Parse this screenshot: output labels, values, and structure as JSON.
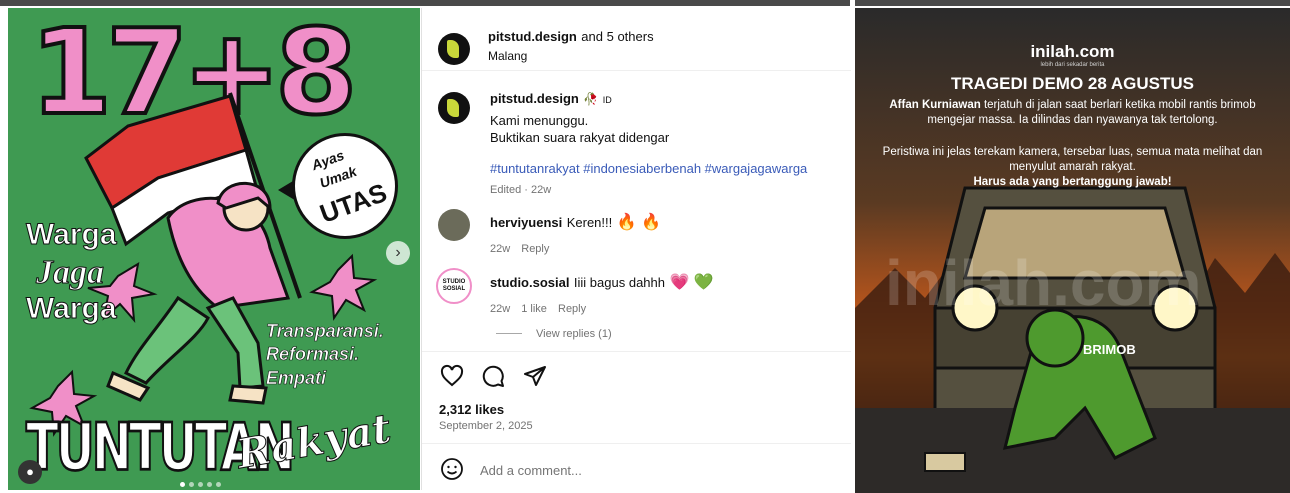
{
  "left_post": {
    "numbers": "17+8",
    "bubble_lines": [
      "Ayas",
      "Umak",
      "UTAS"
    ],
    "warga": [
      "Warga",
      "Jaga",
      "Warga"
    ],
    "slogans": [
      "Transparansi.",
      "Reformasi.",
      "Empati"
    ],
    "bottom_left": "TUNTUTAN",
    "bottom_right": "Rakyat",
    "colors": {
      "background": "#3f9a52",
      "accent": "#f08fc8"
    }
  },
  "instagram": {
    "header": {
      "username": "pitstud.design",
      "others": "and 5 others",
      "location": "Malang"
    },
    "caption": {
      "username": "pitstud.design",
      "badge": "ID",
      "lines": [
        "Kami menunggu.",
        "Buktikan suara rakyat didengar"
      ],
      "hashtags": "#tuntutanrakyat #indonesiaberbenah #wargajagawarga",
      "edited": "Edited · 22w"
    },
    "comments": [
      {
        "username": "herviyuensi",
        "text": "Keren!!!",
        "emoji": "🔥 🔥",
        "time": "22w",
        "reply": "Reply"
      },
      {
        "username": "studio.sosial",
        "text": "Iiii bagus dahhh",
        "emoji": "💗 💚",
        "time": "22w",
        "likes": "1 like",
        "reply": "Reply",
        "avatar_text": "STUDIO SOSIAL"
      }
    ],
    "view_replies": "View replies (1)",
    "likes": "2,312 likes",
    "date": "September 2, 2025",
    "add_comment_placeholder": "Add a comment..."
  },
  "right_post": {
    "brand": "inilah.com",
    "brand_sub": "lebih dari sekadar berita",
    "title": "TRAGEDI DEMO 28 AGUSTUS",
    "para1_bold": "Affan Kurniawan",
    "para1_rest": " terjatuh di jalan saat berlari ketika mobil rantis brimob mengejar massa. Ia dilindas dan nyawanya tak tertolong.",
    "para2": "Peristiwa ini jelas terekam kamera, tersebar luas, semua mata melihat dan menyulut amarah rakyat.",
    "para2_bold": "Harus ada yang bertanggung jawab!",
    "vehicle_text": "BRIMOB",
    "watermark": "inilah.com"
  }
}
